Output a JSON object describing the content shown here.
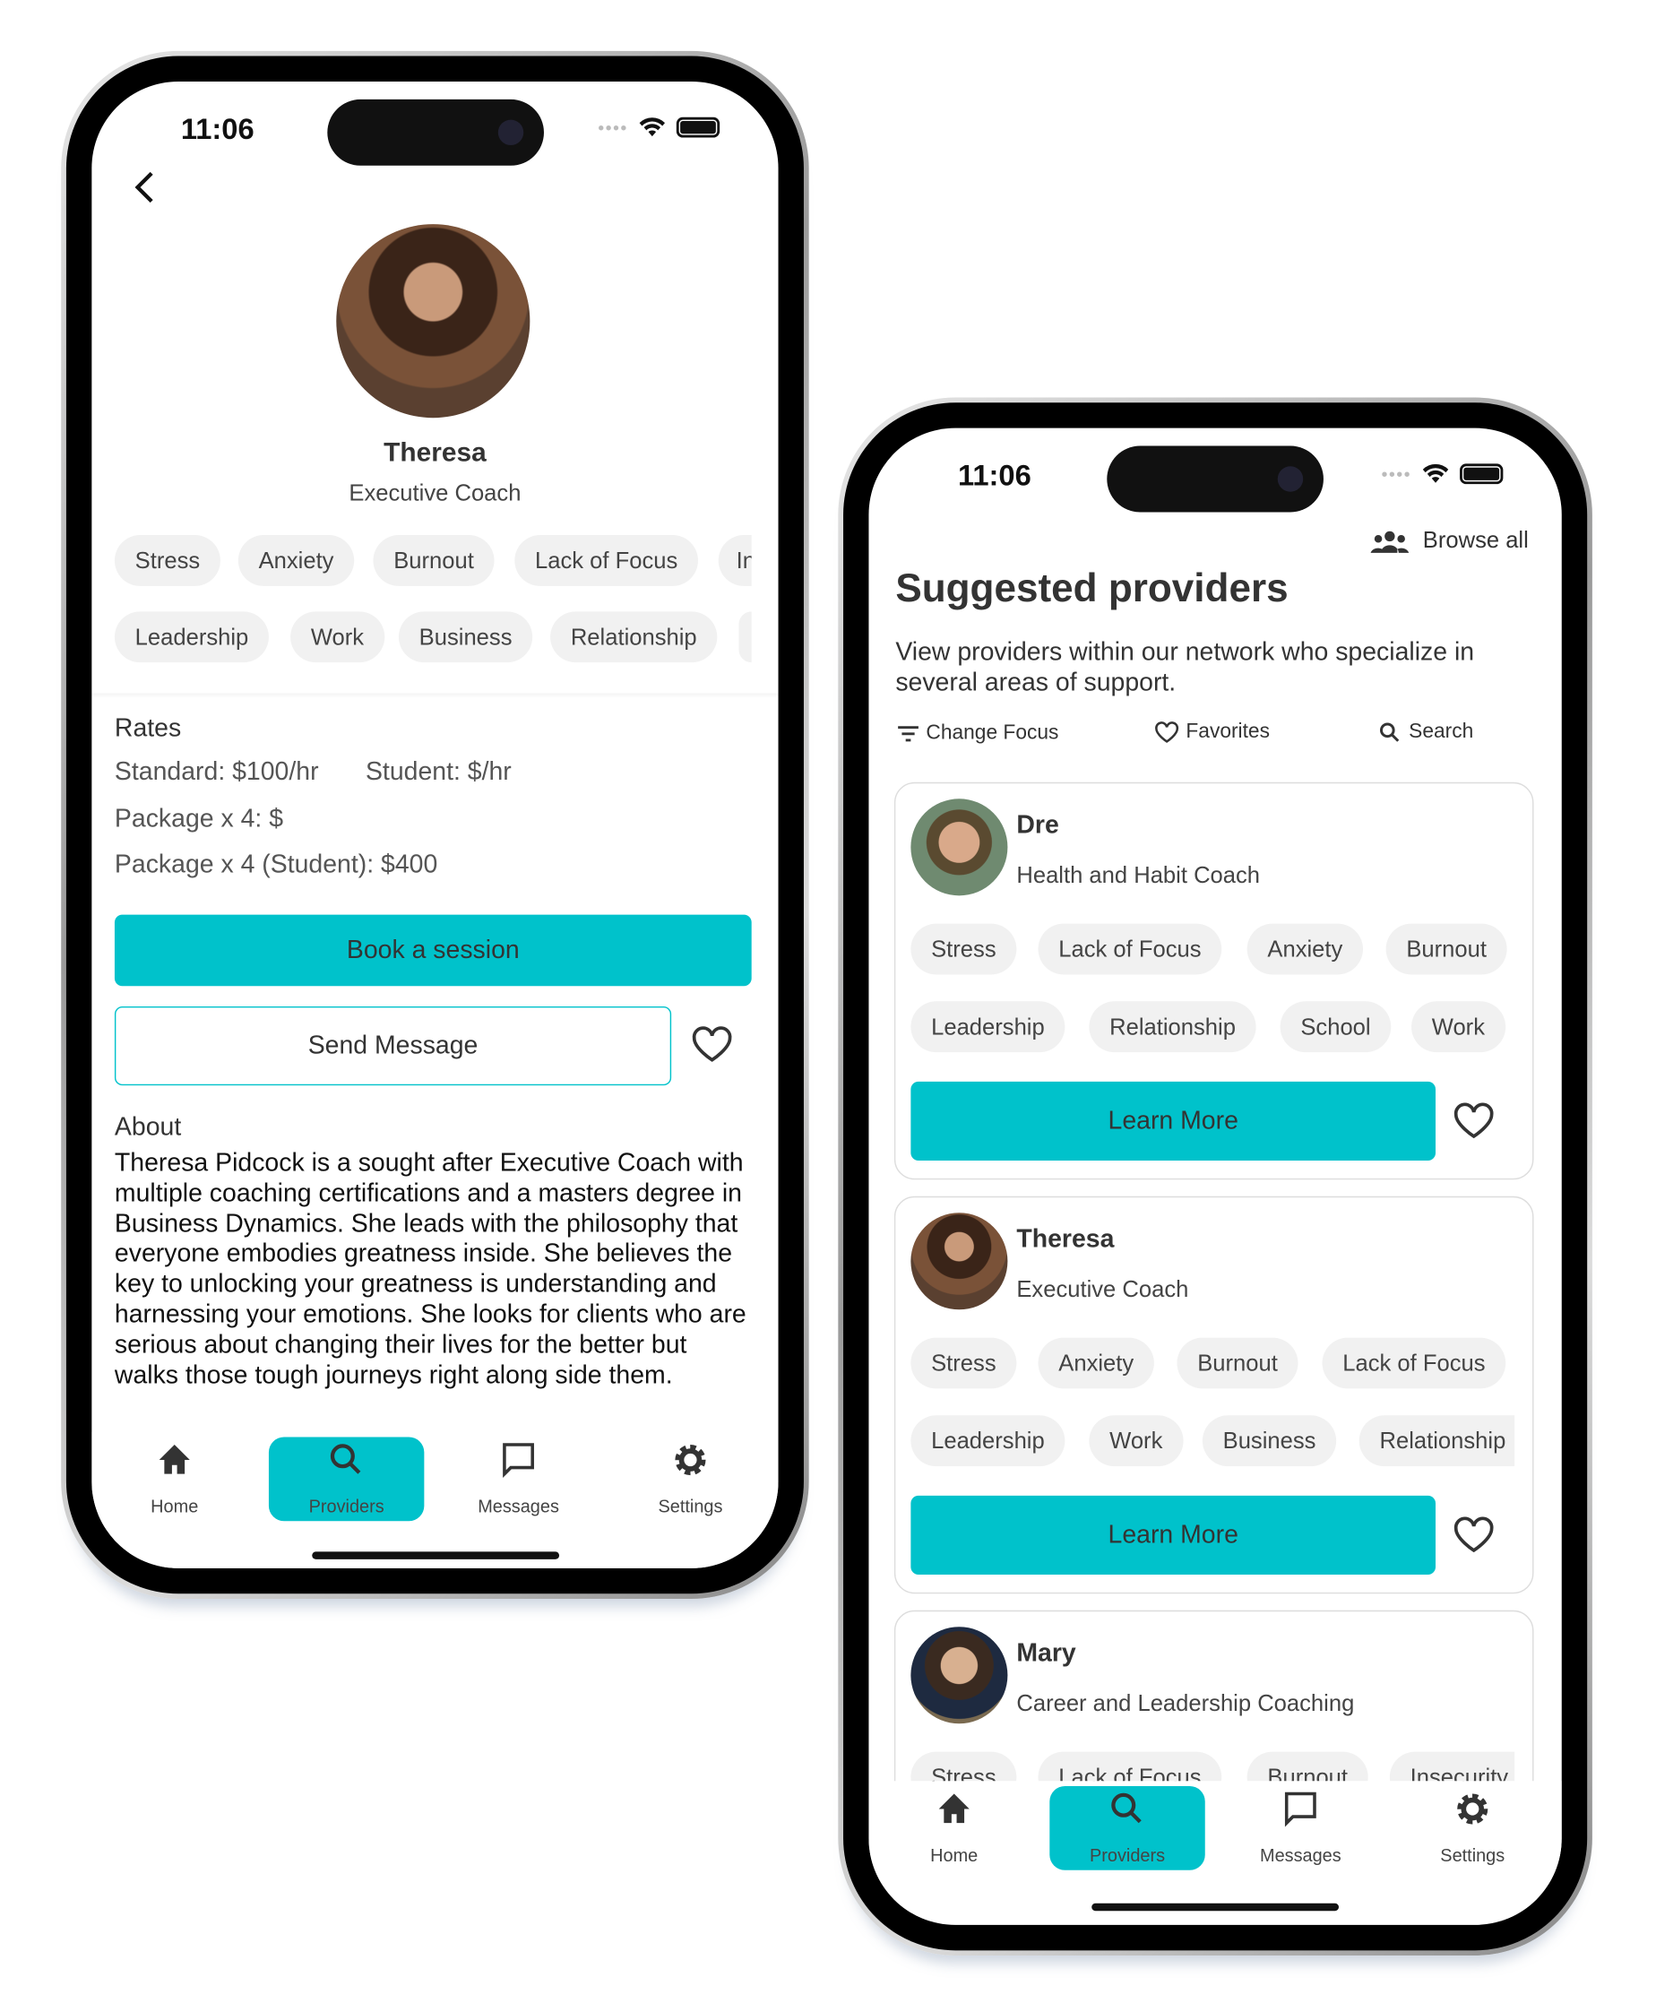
{
  "colors": {
    "accent": "#00C2CB",
    "chip_bg": "#f1f1f1"
  },
  "status_bar": {
    "time": "11:06"
  },
  "profile_screen": {
    "back_icon": "chevron-left-icon",
    "name": "Theresa",
    "role": "Executive Coach",
    "tags_row1": [
      "Stress",
      "Anxiety",
      "Burnout",
      "Lack of Focus",
      "In"
    ],
    "tags_row2": [
      "Leadership",
      "Work",
      "Business",
      "Relationship"
    ],
    "rates": {
      "title": "Rates",
      "standard": "Standard: $100/hr",
      "student": "Student: $/hr",
      "package": "Package x 4: $",
      "package_student": "Package x 4 (Student): $400"
    },
    "book_label": "Book a session",
    "message_label": "Send Message",
    "about_title": "About",
    "about_text": "Theresa Pidcock is a sought after Executive Coach with multiple coaching certifications and a masters degree in Business Dynamics. She leads with the philosophy that everyone embodies greatness inside. She believes the key to unlocking your greatness is understanding and harnessing your emotions. She looks for clients who are serious about changing their lives for the better but walks those tough journeys right along side them."
  },
  "list_screen": {
    "browse_all": "Browse all",
    "title": "Suggested providers",
    "subtitle": "View providers within our network who specialize in several areas of support.",
    "filters": [
      {
        "label": "Change Focus",
        "icon": "filter-icon"
      },
      {
        "label": "Favorites",
        "icon": "heart-icon"
      },
      {
        "label": "Search",
        "icon": "search-icon"
      }
    ],
    "learn_more": "Learn More",
    "providers": [
      {
        "name": "Dre",
        "role": "Health and Habit Coach",
        "tags1": [
          "Stress",
          "Lack of Focus",
          "Anxiety",
          "Burnout"
        ],
        "tags2": [
          "Leadership",
          "Relationship",
          "School",
          "Work"
        ]
      },
      {
        "name": "Theresa",
        "role": "Executive Coach",
        "tags1": [
          "Stress",
          "Anxiety",
          "Burnout",
          "Lack of Focus"
        ],
        "tags2": [
          "Leadership",
          "Work",
          "Business",
          "Relationship"
        ]
      },
      {
        "name": "Mary",
        "role": "Career and Leadership Coaching",
        "tags1": [
          "Stress",
          "Lack of Focus",
          "Burnout",
          "Insecurity"
        ]
      }
    ]
  },
  "nav": [
    {
      "label": "Home",
      "icon": "home-icon"
    },
    {
      "label": "Providers",
      "icon": "search-icon",
      "active": true
    },
    {
      "label": "Messages",
      "icon": "message-icon"
    },
    {
      "label": "Settings",
      "icon": "gear-icon"
    }
  ]
}
